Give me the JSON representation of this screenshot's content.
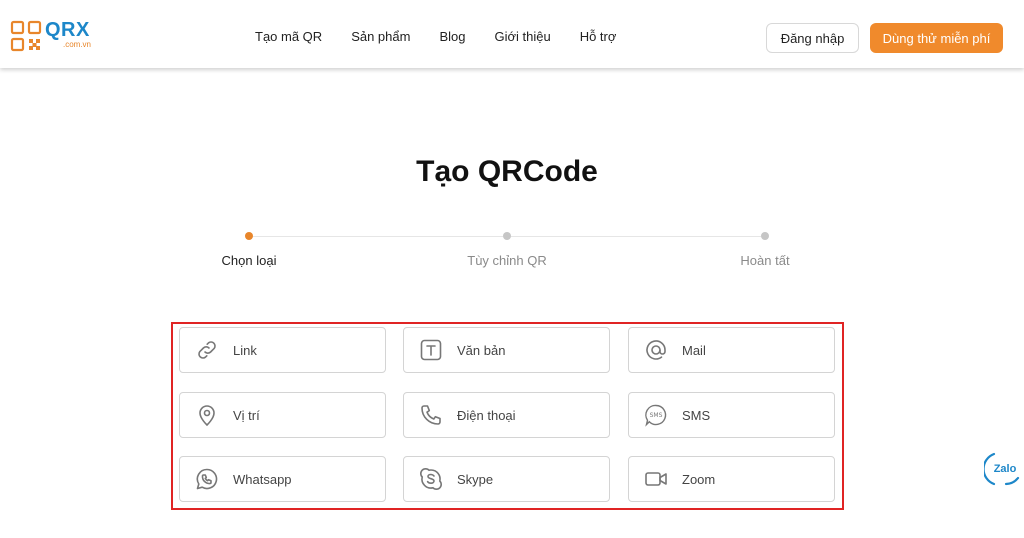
{
  "header": {
    "logo": {
      "title": "QRX",
      "subtitle": ".com.vn"
    },
    "nav": [
      {
        "label": "Tạo mã QR"
      },
      {
        "label": "Sản phẩm"
      },
      {
        "label": "Blog"
      },
      {
        "label": "Giới thiệu"
      },
      {
        "label": "Hỗ trợ"
      }
    ],
    "login_label": "Đăng nhập",
    "trial_label": "Dùng thử miễn phí"
  },
  "page": {
    "title": "Tạo QRCode"
  },
  "stepper": [
    {
      "label": "Chọn loại",
      "active": true
    },
    {
      "label": "Tùy chỉnh QR",
      "active": false
    },
    {
      "label": "Hoàn tất",
      "active": false
    }
  ],
  "qr_types": [
    {
      "label": "Link",
      "icon": "link-icon"
    },
    {
      "label": "Văn bản",
      "icon": "text-icon"
    },
    {
      "label": "Mail",
      "icon": "at-icon"
    },
    {
      "label": "Vị trí",
      "icon": "location-pin-icon"
    },
    {
      "label": "Điện thoại",
      "icon": "phone-icon"
    },
    {
      "label": "SMS",
      "icon": "sms-icon"
    },
    {
      "label": "Whatsapp",
      "icon": "whatsapp-icon"
    },
    {
      "label": "Skype",
      "icon": "skype-icon"
    },
    {
      "label": "Zoom",
      "icon": "video-camera-icon"
    }
  ],
  "zalo": {
    "label": "Zalo",
    "icon": "zalo-chat-icon"
  },
  "colors": {
    "accent": "#f08a2c",
    "brand_blue": "#1d87c9",
    "highlight_frame": "#e02424"
  }
}
